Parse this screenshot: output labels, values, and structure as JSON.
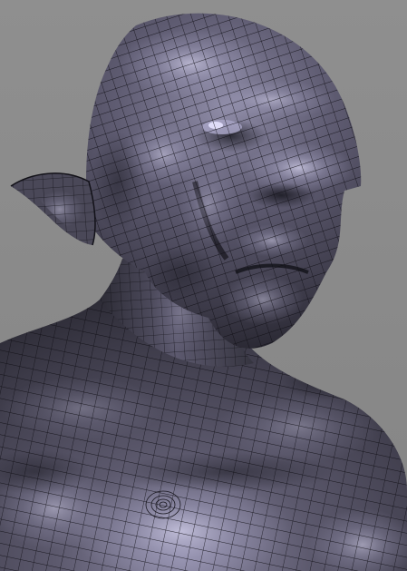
{
  "scene": {
    "subject": "sculpted-head-wireframe-render",
    "colors": {
      "background": "#8c8c8c",
      "skin_base": "#4a4856",
      "skin_highlight": "#b9b6d4",
      "skin_shadow": "#1c1b24",
      "wire": "#0d0c12"
    }
  }
}
